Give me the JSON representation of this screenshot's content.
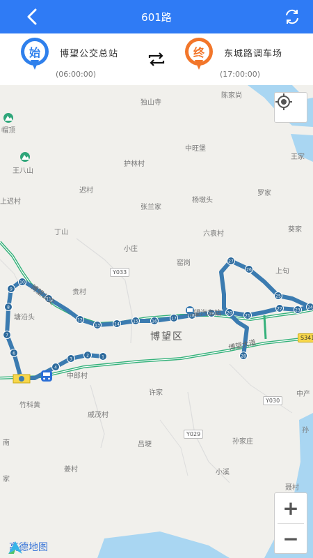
{
  "header": {
    "title": "601路"
  },
  "route": {
    "start": {
      "badge": "始",
      "name": "博望公交总站",
      "time": "(06:00:00)"
    },
    "end": {
      "badge": "终",
      "name": "东城路调车场",
      "time": "(17:00:00)"
    }
  },
  "map": {
    "places": [
      "独山寺",
      "陈家尚",
      "王家",
      "帽顶",
      "王八山",
      "中旺堡",
      "护林村",
      "迟村",
      "罗家",
      "上迟村",
      "张兰家",
      "杨墩头",
      "丁山",
      "六袁村",
      "葵家",
      "小庄",
      "窑岗",
      "上句",
      "贵村",
      "塘沿头",
      "博望区",
      "中郎村",
      "竹科黄",
      "许家",
      "中产",
      "戚茂村",
      "吕埂",
      "孙家庄",
      "孙",
      "南",
      "姜村",
      "小溪",
      "家",
      "聂村"
    ],
    "road_labels": [
      "Y033",
      "S341",
      "Y030",
      "Y029",
      "博望大道",
      "博望汽车站",
      "博望公交"
    ],
    "stop_numbers": [
      "1",
      "2",
      "3",
      "4",
      "5",
      "6",
      "7",
      "8",
      "9",
      "10",
      "11",
      "12",
      "13",
      "14",
      "15",
      "16",
      "17",
      "18",
      "19",
      "20",
      "21",
      "22",
      "23",
      "24",
      "25",
      "26",
      "27",
      "28"
    ],
    "zoom_in": "+",
    "zoom_out": "−",
    "logo_text": "高德地图"
  },
  "colors": {
    "header": "#2f7bf5",
    "route_line": "#3b7bb0",
    "start_pin": "#2f80ec",
    "end_pin": "#f2762a",
    "road_green": "#34b17a"
  }
}
